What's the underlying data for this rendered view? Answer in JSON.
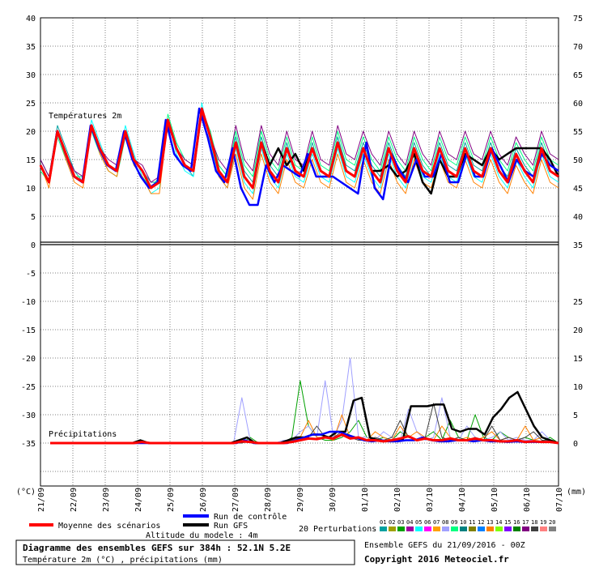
{
  "chart_data": {
    "type": "line",
    "top_panel": {
      "label": "Températures 2m",
      "left_ticks": [
        "40",
        "35",
        "30",
        "25",
        "20",
        "15",
        "10",
        "5",
        "0"
      ],
      "right_ticks": [
        "75",
        "70",
        "65",
        "60",
        "55",
        "50",
        "45",
        "40",
        "35"
      ],
      "mean": [
        14,
        11,
        20,
        16,
        12,
        11,
        21,
        17,
        14,
        13,
        20,
        15,
        13,
        10,
        11,
        22,
        17,
        14,
        13,
        24,
        19,
        13,
        11,
        18,
        12,
        10,
        18,
        13,
        11,
        17,
        13,
        12,
        17,
        13,
        12,
        18,
        13,
        12,
        17,
        13,
        11,
        17,
        13,
        11,
        17,
        13,
        12,
        17,
        13,
        12,
        17,
        13,
        12,
        17,
        13,
        11,
        16,
        13,
        11,
        17,
        13,
        12
      ],
      "control": [
        14,
        11,
        20,
        16,
        12,
        11,
        21,
        17,
        14,
        13,
        20,
        15,
        12,
        10,
        11,
        22,
        16,
        14,
        13,
        24,
        19,
        13,
        11,
        17,
        10,
        7,
        7,
        14,
        11,
        14,
        13,
        12,
        16,
        12,
        12,
        12,
        11,
        10,
        9,
        18,
        10,
        8,
        16,
        13,
        11,
        15,
        12,
        12,
        16,
        11,
        11,
        16,
        12,
        12,
        17,
        14,
        11,
        15,
        13,
        12,
        16,
        14,
        13
      ],
      "gfs": [
        14,
        11,
        20,
        16,
        12,
        11,
        21,
        17,
        14,
        13,
        20,
        15,
        13,
        10,
        11,
        22,
        17,
        14,
        13,
        24,
        19,
        13,
        11,
        18,
        12,
        10,
        18,
        14,
        17,
        14,
        16,
        13,
        17,
        13,
        12,
        18,
        13,
        12,
        17,
        13,
        13,
        14,
        12,
        13,
        16,
        11,
        9,
        15,
        12,
        12,
        16,
        15,
        14,
        17,
        15,
        16,
        17,
        17,
        17,
        17,
        15,
        12
      ],
      "perturbations": [
        [
          15,
          12,
          21,
          17,
          13,
          11,
          21,
          17,
          14,
          13,
          20,
          15,
          13,
          11,
          11,
          21,
          17,
          14,
          12,
          23,
          19,
          14,
          12,
          19,
          13,
          11,
          19,
          14,
          12,
          18,
          13,
          12,
          18,
          13,
          12,
          19,
          14,
          13,
          18,
          14,
          12,
          18,
          14,
          12,
          18,
          14,
          12,
          18,
          14,
          13,
          18,
          14,
          13,
          18,
          14,
          12,
          17,
          14,
          12,
          18,
          14,
          13
        ],
        [
          14,
          11,
          20,
          16,
          12,
          11,
          22,
          18,
          14,
          13,
          21,
          16,
          12,
          9,
          10,
          22,
          16,
          13,
          12,
          25,
          18,
          12,
          10,
          17,
          11,
          9,
          17,
          12,
          10,
          16,
          12,
          11,
          16,
          12,
          11,
          17,
          12,
          11,
          16,
          12,
          10,
          16,
          12,
          10,
          16,
          12,
          11,
          16,
          12,
          11,
          16,
          12,
          11,
          16,
          12,
          10,
          15,
          12,
          10,
          16,
          12,
          11
        ],
        [
          13,
          11,
          19,
          15,
          12,
          12,
          20,
          16,
          13,
          12,
          19,
          14,
          12,
          10,
          12,
          23,
          18,
          15,
          14,
          24,
          20,
          14,
          12,
          20,
          14,
          12,
          20,
          15,
          13,
          19,
          14,
          13,
          19,
          14,
          13,
          20,
          15,
          14,
          19,
          15,
          13,
          19,
          15,
          13,
          19,
          15,
          13,
          19,
          15,
          14,
          19,
          15,
          14,
          19,
          15,
          13,
          18,
          15,
          13,
          19,
          15,
          14
        ],
        [
          14,
          10,
          20,
          15,
          11,
          10,
          21,
          16,
          13,
          12,
          20,
          14,
          12,
          9,
          9,
          22,
          17,
          14,
          13,
          24,
          19,
          12,
          10,
          16,
          10,
          8,
          16,
          11,
          9,
          15,
          11,
          10,
          15,
          11,
          10,
          16,
          11,
          10,
          15,
          11,
          9,
          15,
          11,
          9,
          15,
          11,
          10,
          15,
          11,
          10,
          15,
          11,
          10,
          15,
          11,
          9,
          14,
          11,
          9,
          15,
          11,
          10
        ],
        [
          15,
          12,
          20,
          16,
          13,
          12,
          21,
          17,
          15,
          14,
          20,
          15,
          14,
          11,
          12,
          21,
          17,
          15,
          14,
          23,
          19,
          15,
          13,
          21,
          15,
          13,
          21,
          16,
          14,
          20,
          15,
          14,
          20,
          15,
          14,
          21,
          16,
          15,
          20,
          16,
          14,
          20,
          16,
          14,
          20,
          16,
          14,
          20,
          16,
          15,
          20,
          16,
          15,
          20,
          16,
          14,
          19,
          16,
          14,
          20,
          16,
          15
        ]
      ]
    },
    "bottom_panel": {
      "label": "Précipitations",
      "left_ticks": [
        "-5",
        "-10",
        "-15",
        "-20",
        "-25",
        "-30",
        "-35"
      ],
      "right_ticks": [
        "25",
        "20",
        "15",
        "10",
        "5",
        "0"
      ],
      "mean": [
        0,
        0,
        0,
        0,
        0,
        0,
        0,
        0,
        0,
        0,
        0,
        0.2,
        0,
        0,
        0,
        0,
        0,
        0,
        0,
        0,
        0,
        0,
        0,
        0.3,
        0.2,
        0,
        0,
        0,
        0,
        0.2,
        0.5,
        0.8,
        0.7,
        1,
        0.8,
        1.5,
        0.8,
        1,
        0.5,
        0.5,
        0.3,
        0.5,
        0.8,
        1.2,
        0.5,
        0.8,
        0.5,
        0.5,
        0.8,
        0.5,
        0.5,
        0.8,
        0.5,
        0.5,
        0.3,
        0.3,
        0.5,
        0.2,
        0.3,
        0.2,
        0.2,
        0
      ],
      "gfs": [
        0,
        0,
        0,
        0,
        0,
        0,
        0,
        0,
        0,
        0,
        0,
        0.5,
        0,
        0,
        0,
        0,
        0,
        0,
        0,
        0,
        0,
        0,
        0,
        0.5,
        1,
        0,
        0,
        0,
        0,
        0.5,
        1,
        1,
        1.5,
        1.5,
        1,
        2,
        2,
        7.5,
        8,
        1,
        0.5,
        0.3,
        0.5,
        0.5,
        6.5,
        6.5,
        6.5,
        6.8,
        6.8,
        2.5,
        2,
        2.5,
        2.5,
        1.5,
        4.5,
        6,
        8,
        9,
        6,
        3,
        1,
        0.5,
        0
      ],
      "control": [
        0,
        0,
        0,
        0,
        0,
        0,
        0,
        0,
        0,
        0,
        0,
        0,
        0,
        0,
        0,
        0,
        0,
        0,
        0,
        0,
        0,
        0,
        0,
        0.5,
        0,
        0,
        0,
        0,
        0,
        0.5,
        1,
        1.5,
        1.5,
        2,
        2,
        1.5,
        1,
        0.5,
        0.3,
        0.5,
        0.3,
        0.3,
        0.5,
        0.5,
        1,
        0.5,
        0.3,
        0.3,
        0.5,
        0.5,
        0.3,
        0.5,
        0.3,
        0.3,
        0.2,
        0.3,
        0.2,
        0.2,
        0.2,
        0.2,
        0
      ],
      "perturbations": [
        [
          0,
          0,
          0,
          0,
          0,
          0,
          0,
          0,
          0,
          0,
          0,
          0.5,
          0,
          0,
          0,
          0,
          0,
          0,
          0,
          0,
          0,
          0,
          0,
          0,
          1,
          0,
          0,
          0,
          0,
          1,
          11,
          3,
          1,
          0.5,
          0.5,
          1,
          2,
          4,
          1,
          0.5,
          1,
          0.5,
          2,
          1,
          0.5,
          1,
          2,
          0.5,
          4,
          1,
          0.5,
          5,
          1,
          0.5,
          2,
          1,
          0.5,
          1,
          0.5,
          0.3,
          1,
          0
        ],
        [
          0,
          0,
          0,
          0,
          0,
          0,
          0,
          0,
          0,
          0,
          0,
          0,
          0,
          0,
          0,
          0,
          0,
          0,
          0,
          0,
          0,
          0,
          0,
          8,
          0.5,
          0,
          0,
          0,
          0.5,
          0.5,
          2,
          3,
          1,
          11,
          1,
          4,
          15,
          1,
          1,
          0.5,
          2,
          1,
          0.5,
          6,
          2,
          0.5,
          1,
          8,
          1,
          0.5,
          3,
          1,
          0.5,
          1,
          2,
          0.5,
          1,
          0.5,
          0.5,
          2,
          0.5,
          0
        ],
        [
          0,
          0,
          0,
          0,
          0,
          0,
          0,
          0,
          0,
          0,
          0,
          0.3,
          0,
          0,
          0,
          0,
          0,
          0,
          0,
          0,
          0,
          0,
          0,
          0,
          0.5,
          0,
          0,
          0,
          0,
          0.5,
          1,
          4,
          1,
          1,
          0.5,
          5,
          1,
          1,
          0.5,
          2,
          1,
          0.5,
          3,
          1,
          2,
          1,
          0.5,
          3,
          1,
          0.5,
          1,
          0.5,
          1,
          2,
          0.5,
          1,
          0.5,
          3,
          0.5,
          1,
          0.5,
          0
        ],
        [
          0,
          0,
          0,
          0,
          0,
          0,
          0,
          0,
          0,
          0,
          0,
          0,
          0,
          0,
          0,
          0,
          0,
          0,
          0,
          0,
          0,
          0,
          0,
          0,
          0.5,
          0,
          0,
          0,
          0,
          0.5,
          1,
          1,
          3,
          1,
          1,
          2,
          1,
          0.5,
          0.5,
          1,
          0.5,
          1,
          4,
          1,
          0.5,
          1,
          7,
          1,
          0.5,
          1,
          0.5,
          1,
          0.5,
          3,
          0.5,
          1,
          0.5,
          1,
          2,
          0.5,
          0.5,
          0
        ]
      ]
    },
    "x_labels": [
      "21/09",
      "22/09",
      "23/09",
      "24/09",
      "25/09",
      "26/09",
      "27/09",
      "28/09",
      "29/09",
      "30/09",
      "01/10",
      "02/10",
      "03/10",
      "04/10",
      "05/10",
      "06/10",
      "07/10"
    ],
    "left_unit": "(°C)",
    "right_unit": "(mm)",
    "colors": {
      "mean": "#ff0000",
      "control": "#0000ff",
      "gfs": "#000000"
    },
    "perturbation_colors": [
      "#00a0a0",
      "#a0a000",
      "#00a000",
      "#a000a0",
      "#00ffff",
      "#ff00ff",
      "#ffa000",
      "#a0a0ff",
      "#00ff80",
      "#008080",
      "#808000",
      "#0080ff",
      "#ff8000",
      "#80ff00",
      "#8000ff",
      "#008000",
      "#800080",
      "#404040",
      "#ff8080",
      "#808080"
    ]
  },
  "legend": {
    "mean": "Moyenne des scénarios",
    "control": "Run de contrôle",
    "gfs": "Run GFS",
    "altitude": "Altitude du modele : 4m",
    "perturbations": "20 Perturbations",
    "pert_numbers": [
      "01",
      "02",
      "03",
      "04",
      "05",
      "06",
      "07",
      "08",
      "09",
      "10",
      "11",
      "12",
      "13",
      "14",
      "15",
      "16",
      "17",
      "18",
      "19",
      "20"
    ]
  },
  "footer": {
    "title": "Diagramme des ensembles GEFS sur 384h : 52.1N 5.2E",
    "subtitle": "Température 2m (°C) , précipitations (mm)",
    "run": "Ensemble GEFS du 21/09/2016 - 00Z",
    "copyright": "Copyright 2016 Meteociel.fr"
  }
}
